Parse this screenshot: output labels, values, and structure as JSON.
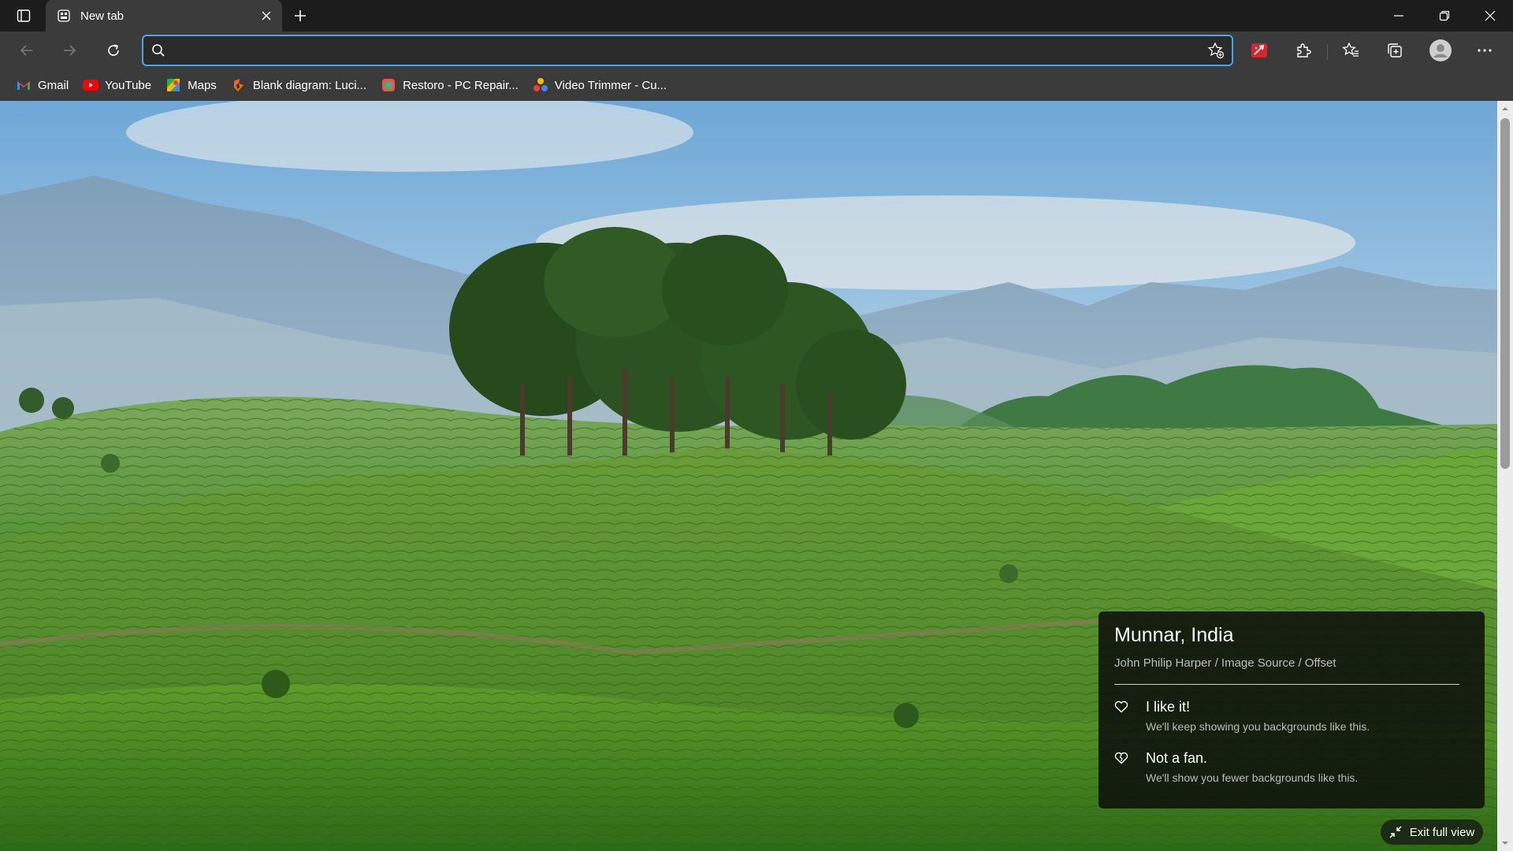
{
  "tab": {
    "title": "New tab",
    "close_icon": "close-icon",
    "favicon": "new-tab-page-icon"
  },
  "tabstrip": {
    "tab_actions_icon": "tab-actions-icon",
    "new_tab_icon": "plus-icon"
  },
  "window_controls": {
    "minimize_icon": "minimize-icon",
    "restore_icon": "restore-icon",
    "close_icon": "close-icon"
  },
  "toolbar": {
    "back_icon": "back-arrow-icon",
    "forward_icon": "forward-arrow-icon",
    "refresh_icon": "refresh-icon",
    "address_value": "",
    "search_icon": "search-icon",
    "favorite_add_icon": "star-add-icon",
    "extension_red_icon": "red-extension-icon",
    "extensions_icon": "puzzle-icon",
    "favorites_icon": "favorites-icon",
    "collections_icon": "collections-icon",
    "profile_icon": "profile-avatar-icon",
    "menu_icon": "more-icon"
  },
  "bookmarks": [
    {
      "label": "Gmail",
      "icon": "gmail-icon",
      "color": "#ea4335"
    },
    {
      "label": "YouTube",
      "icon": "youtube-icon",
      "color": "#ff0000"
    },
    {
      "label": "Maps",
      "icon": "maps-icon",
      "color": "#34a853"
    },
    {
      "label": "Blank diagram: Luci...",
      "icon": "lucidchart-icon",
      "color": "#f96b13"
    },
    {
      "label": "Restoro - PC Repair...",
      "icon": "restoro-icon",
      "color": "#4caf50"
    },
    {
      "label": "Video Trimmer - Cu...",
      "icon": "video-trimmer-icon",
      "color": "#fbbc04"
    }
  ],
  "background_info": {
    "location": "Munnar, India",
    "credit": "John Philip Harper / Image Source / Offset",
    "like": {
      "title": "I like it!",
      "subtitle": "We'll keep showing you backgrounds like this."
    },
    "dislike": {
      "title": "Not a fan.",
      "subtitle": "We'll show you fewer backgrounds like this."
    }
  },
  "exit_full_view": {
    "label": "Exit full view",
    "icon": "collapse-icon"
  },
  "colors": {
    "accent": "#4aa6ea",
    "chrome_bg": "#3b3b3b",
    "tabstrip_bg": "#1c1c1c"
  }
}
